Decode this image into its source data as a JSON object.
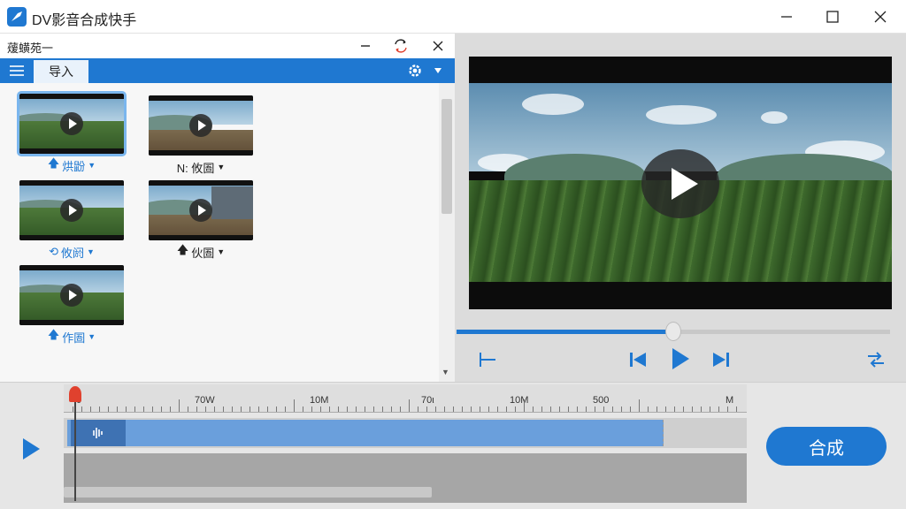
{
  "window": {
    "title": "DV影音合成快手"
  },
  "media_panel": {
    "title": "蕿蟥苑一",
    "toolbar": {
      "import_tab": "导入"
    },
    "items": [
      {
        "caption": "烘鼢",
        "style": "blue"
      },
      {
        "caption": "N: 攸圄",
        "style": "dark"
      },
      {
        "caption": "攸阏",
        "style": "blue"
      },
      {
        "caption": "伙圄",
        "style": "dark"
      },
      {
        "caption": "作圄",
        "style": "blue"
      }
    ]
  },
  "preview": {
    "progress": 0.5
  },
  "timeline": {
    "ruler_labels": [
      "0",
      "70W",
      "10M",
      "70ι",
      "10M",
      "500",
      "M"
    ]
  },
  "actions": {
    "merge": "合成"
  },
  "colors": {
    "accent": "#1f78d1",
    "clip": "#6a9fdc",
    "playhead": "#e0412e"
  }
}
